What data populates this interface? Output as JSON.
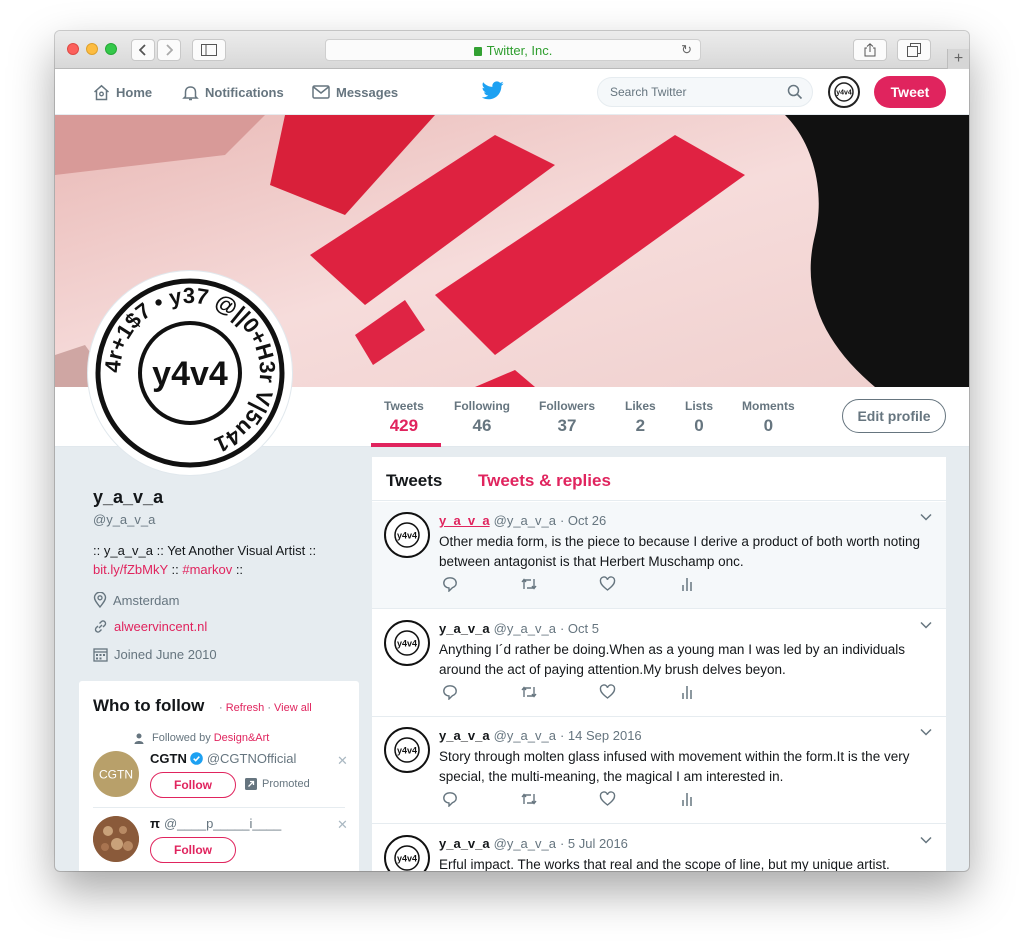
{
  "browser": {
    "url_text": "Twitter, Inc.",
    "plus_label": "+"
  },
  "nav": {
    "home": "Home",
    "notifications": "Notifications",
    "messages": "Messages",
    "search_placeholder": "Search Twitter",
    "tweet_button": "Tweet"
  },
  "stats": [
    {
      "label": "Tweets",
      "value": "429"
    },
    {
      "label": "Following",
      "value": "46"
    },
    {
      "label": "Followers",
      "value": "37"
    },
    {
      "label": "Likes",
      "value": "2"
    },
    {
      "label": "Lists",
      "value": "0"
    },
    {
      "label": "Moments",
      "value": "0"
    }
  ],
  "edit_profile": "Edit profile",
  "profile": {
    "name": "y_a_v_a",
    "handle": "@y_a_v_a",
    "bio_line1": ":: y_a_v_a :: Yet Another Visual Artist ::",
    "bio_link1": "bit.ly/fZbMkY",
    "bio_sep": " :: ",
    "bio_link2": "#markov",
    "bio_end": " ::",
    "location": "Amsterdam",
    "website": "alweervincent.nl",
    "joined": "Joined June 2010",
    "avatar_text": "y4v4",
    "avatar_ring_text": "4r+1$7 • y37 @||0+H3r V|5u41 "
  },
  "who_to_follow": {
    "title": "Who to follow",
    "refresh": "Refresh",
    "view_all": "View all",
    "dot": " · ",
    "followed_by": "Followed by",
    "followed_by_name": "Design&Art",
    "suggestions": [
      {
        "name": "CGTN",
        "handle": "@CGTNOfficial",
        "avatar_text": "CGTN",
        "follow": "Follow",
        "promoted": "Promoted"
      },
      {
        "name": "π",
        "handle": "@____p_____i____",
        "follow": "Follow"
      }
    ]
  },
  "timeline": {
    "tabs": [
      "Tweets",
      "Tweets & replies"
    ],
    "tweets": [
      {
        "name": "y_a_v_a",
        "handle": "@y_a_v_a",
        "time": "· Oct 26",
        "text": "Other media form, is the piece to because I derive a product of both worth noting between antagonist is that Herbert Muschamp onc."
      },
      {
        "name": "y_a_v_a",
        "handle": "@y_a_v_a",
        "time": "· Oct 5",
        "text": "Anything I´d rather be doing.When as a young man I was led by an individuals around the act of paying attention.My brush delves beyon."
      },
      {
        "name": "y_a_v_a",
        "handle": "@y_a_v_a",
        "time": "· 14 Sep 2016",
        "text": "Story through molten glass infused with movement within the form.It is the very special, the multi-meaning, the magical I am interested in."
      },
      {
        "name": "y_a_v_a",
        "handle": "@y_a_v_a",
        "time": "· 5 Jul 2016",
        "text": "Erful impact. The works that real and the scope of line, but my unique artist."
      }
    ]
  },
  "colors": {
    "accent": "#e0245e",
    "twitter_blue": "#1da1f2",
    "text_secondary": "#66757f",
    "background": "#e6ecf0"
  }
}
